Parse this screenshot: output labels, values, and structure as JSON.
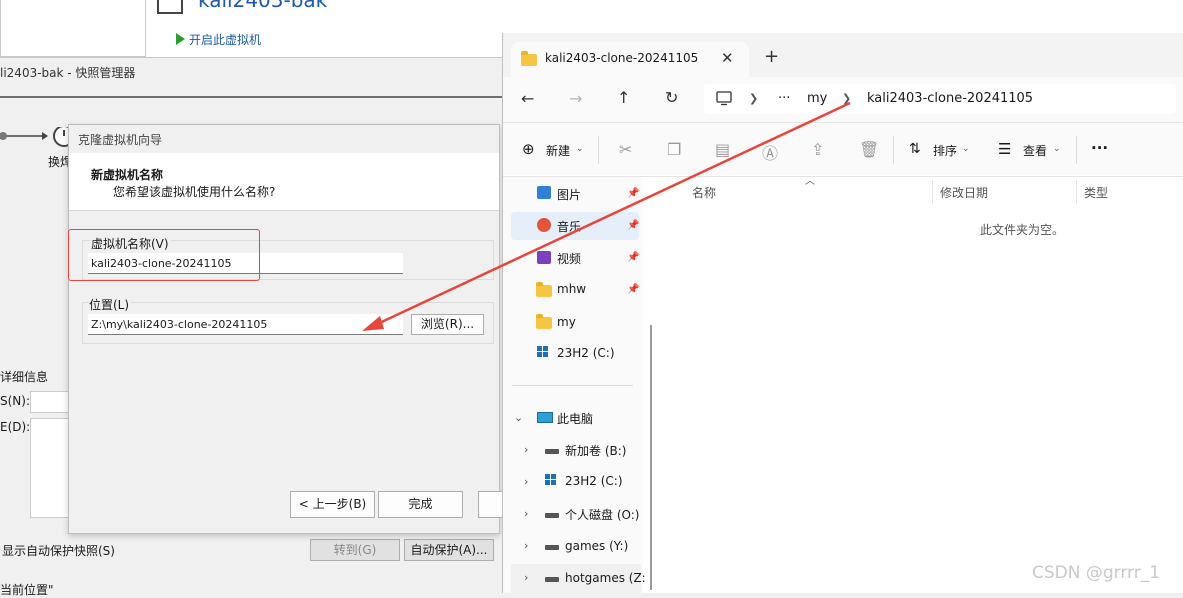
{
  "vmware": {
    "vm_title": "kali2403-bak",
    "start_vm": "开启此虚拟机",
    "snapshot_window_title": "li2403-bak - 快照管理器",
    "timeline_label": "换焊",
    "details_heading": "详细信息",
    "name_label": "S(N):",
    "desc_label": "E(D):",
    "show_autoprotect": "显示自动保护快照(S)",
    "goto_button": "转到(G)",
    "autoprotect_button": "自动保护(A)...",
    "bottom_text": "当前位置\""
  },
  "wizard": {
    "title": "克隆虚拟机向导",
    "heading": "新虚拟机名称",
    "subheading": "您希望该虚拟机使用什么名称?",
    "name_label": "虚拟机名称(V)",
    "name_value": "kali2403-clone-20241105",
    "location_label": "位置(L)",
    "location_value": "Z:\\my\\kali2403-clone-20241105",
    "browse_button": "浏览(R)...",
    "back_button": "< 上一步(B)",
    "finish_button": "完成",
    "highlight_color": "#e8453c"
  },
  "explorer": {
    "tab_title": "kali2403-clone-20241105",
    "tab_close": "✕",
    "new_tab": "+",
    "breadcrumb": [
      "my",
      "kali2403-clone-20241105"
    ],
    "breadcrumb_more": "···",
    "toolbar": {
      "new_label": "新建",
      "sort_label": "排序",
      "view_label": "查看",
      "more_label": "···"
    },
    "nav_quick": [
      {
        "label": "图片",
        "icon": "pictures-icon",
        "pinned": true
      },
      {
        "label": "音乐",
        "icon": "music-icon",
        "pinned": true
      },
      {
        "label": "视频",
        "icon": "videos-icon",
        "pinned": true
      },
      {
        "label": "mhw",
        "icon": "folder-icon",
        "pinned": true
      },
      {
        "label": "my",
        "icon": "folder-icon",
        "pinned": false
      },
      {
        "label": "23H2 (C:)",
        "icon": "windows-drive-icon",
        "pinned": false
      }
    ],
    "this_pc": "此电脑",
    "drives": [
      {
        "label": "新加卷 (B:)",
        "icon": "drive-icon"
      },
      {
        "label": "23H2 (C:)",
        "icon": "windows-drive-icon"
      },
      {
        "label": "个人磁盘 (O:)",
        "icon": "drive-icon"
      },
      {
        "label": "games (Y:)",
        "icon": "drive-icon"
      },
      {
        "label": "hotgames (Z:",
        "icon": "drive-icon"
      }
    ],
    "columns": [
      "名称",
      "修改日期",
      "类型"
    ],
    "empty_message": "此文件夹为空。"
  },
  "watermark": "CSDN @grrrr_1"
}
